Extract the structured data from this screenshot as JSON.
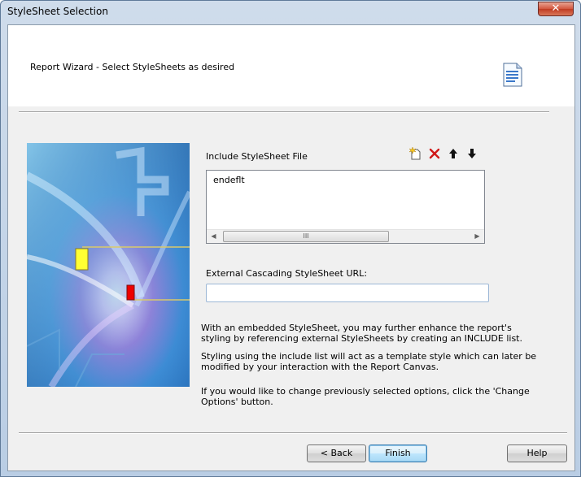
{
  "window": {
    "title": "StyleSheet Selection",
    "close_label": "✕"
  },
  "header": {
    "text": "Report Wizard - Select StyleSheets as desired",
    "icon": "document-icon"
  },
  "include": {
    "label": "Include StyleSheet File",
    "toolbar": [
      {
        "name": "new-icon",
        "glyph": "✳"
      },
      {
        "name": "delete-icon",
        "glyph": "✕"
      },
      {
        "name": "move-up-icon",
        "glyph": "🡅"
      },
      {
        "name": "move-down-icon",
        "glyph": "🡇"
      }
    ],
    "items": [
      "endeflt"
    ],
    "scroll_left": "◀",
    "scroll_right": "▶",
    "thumb_grip": "III"
  },
  "css": {
    "label": "External Cascading StyleSheet URL:",
    "value": ""
  },
  "paragraphs": {
    "p1": "With an embedded StyleSheet, you may further enhance the report's styling by referencing external StyleSheets by creating an INCLUDE list.",
    "p2": "Styling using the include list will act as a template style which can later be modified by your interaction with the Report Canvas.",
    "p3": "If you would like to change previously selected options, click the 'Change Options' button."
  },
  "buttons": {
    "back": "< Back",
    "finish": "Finish",
    "help": "Help"
  }
}
